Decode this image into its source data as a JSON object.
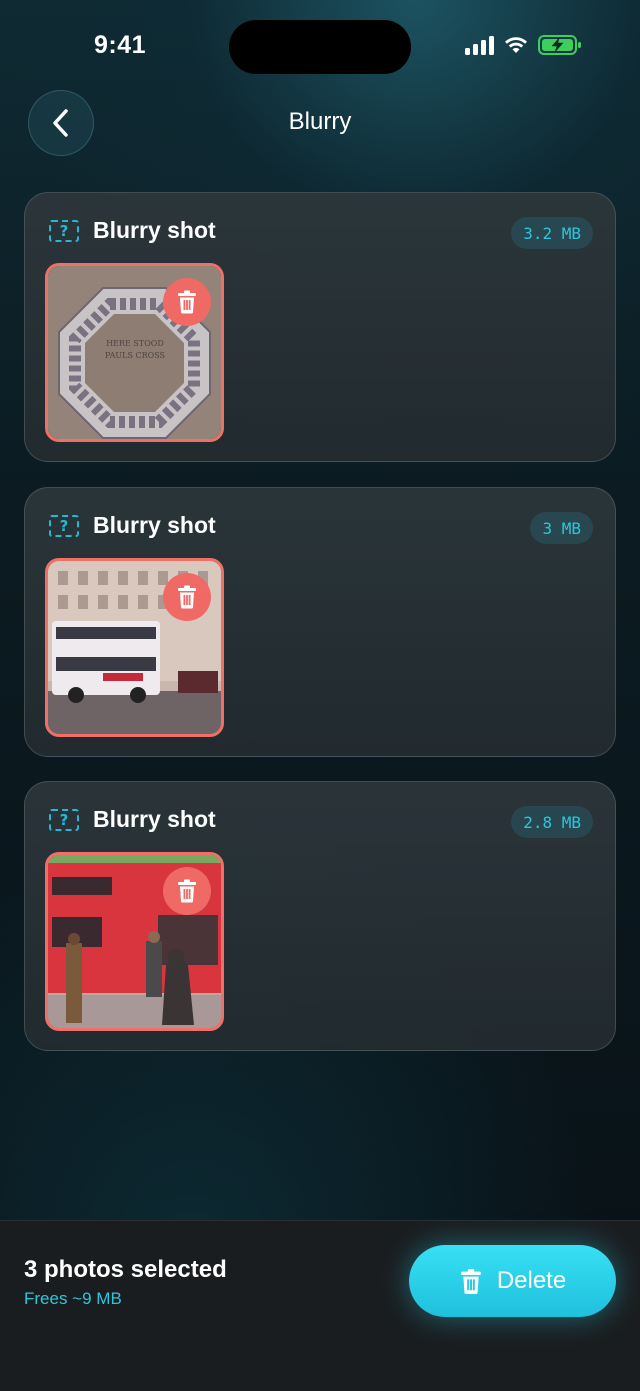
{
  "status": {
    "time": "9:41"
  },
  "header": {
    "title": "Blurry",
    "back_icon": "chevron-left-icon"
  },
  "cards": [
    {
      "title": "Blurry shot",
      "size": "3.2 MB",
      "photo": "pavement-plaque-photo",
      "plaque_line1": "HERE STOOD",
      "plaque_line2": "PAULS CROSS"
    },
    {
      "title": "Blurry shot",
      "size": "3 MB",
      "photo": "white-bus-street-photo"
    },
    {
      "title": "Blurry shot",
      "size": "2.8 MB",
      "photo": "red-bus-crowd-photo"
    }
  ],
  "footer": {
    "selected": "3 photos selected",
    "frees": "Frees ~9 MB",
    "delete_label": "Delete"
  },
  "colors": {
    "accent": "#2cc6dc",
    "danger": "#ef6a64",
    "thumb_border": "#f07068"
  }
}
